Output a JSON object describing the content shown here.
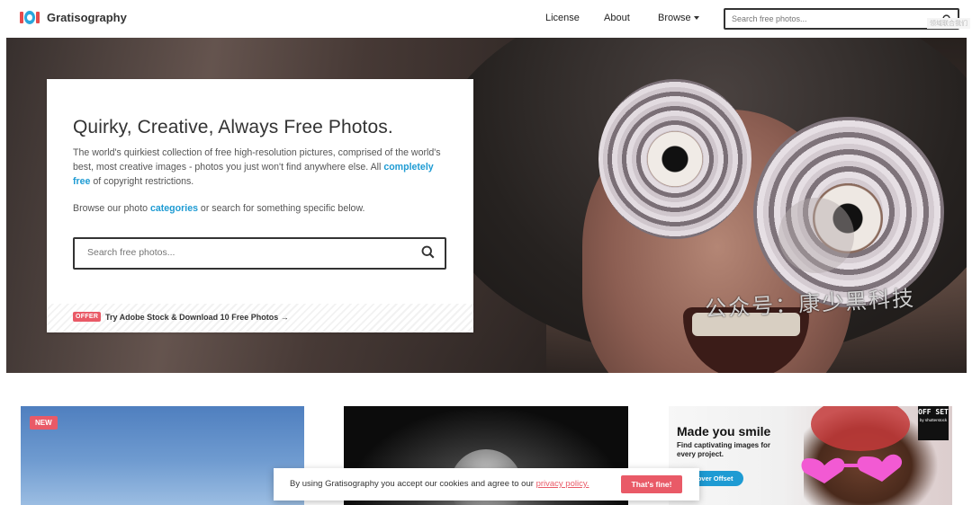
{
  "brand": {
    "name": "Gratisography"
  },
  "nav": {
    "license": "License",
    "about": "About",
    "browse": "Browse"
  },
  "header_search": {
    "placeholder": "Search free photos...",
    "tag": "领域联合我们"
  },
  "hero": {
    "title": "Quirky, Creative, Always Free Photos.",
    "desc_before": "The world's quirkiest collection of free high-resolution pictures, comprised of the world's best, most creative images - photos you just won't find anywhere else. All ",
    "desc_link": "completely free",
    "desc_after": " of copyright restrictions.",
    "browse_before": "Browse our photo ",
    "browse_link": "categories",
    "browse_after": " or search for something specific below.",
    "search_placeholder": "Search free photos...",
    "offer_badge": "OFFER",
    "offer_text": "Try Adobe Stock & Download 10 Free Photos →",
    "watermark": "公众号：康少黑科技"
  },
  "tiles": {
    "new_badge": "NEW",
    "ad_title": "Made you smile",
    "ad_sub": "Find captivating images for every project.",
    "ad_button": "Discover Offset",
    "offset_logo": "OFF SET",
    "offset_by": "by shutterstock"
  },
  "cookie": {
    "message": "By using Gratisography you accept our cookies and agree to our ",
    "link": "privacy policy.",
    "button": "That's fine!"
  },
  "colors": {
    "accent_blue": "#1e9bd3",
    "accent_red": "#e95a67",
    "text": "#333333"
  },
  "icons": {
    "search": "search-icon",
    "caret": "chevron-down-icon",
    "logo": "camera-logo-icon"
  }
}
